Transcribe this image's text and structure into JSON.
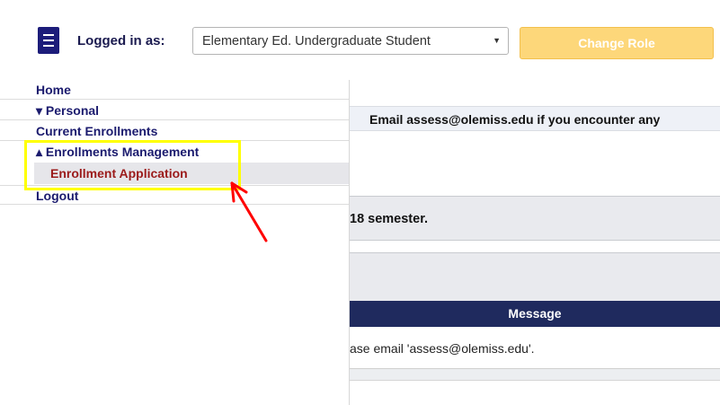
{
  "header": {
    "logged_in_label": "Logged in as:",
    "role_value": "Elementary Ed. Undergraduate Student",
    "change_role_label": "Change Role"
  },
  "sidebar": {
    "items": [
      {
        "label": "Home"
      },
      {
        "label": "▾ Personal"
      },
      {
        "label": "Current Enrollments"
      },
      {
        "label": "▴ Enrollments Management"
      },
      {
        "label": "Enrollment Application"
      },
      {
        "label": "Logout"
      }
    ]
  },
  "main": {
    "email_notice": "Email assess@olemiss.edu if you encounter any",
    "semester_text": "18 semester.",
    "table_header": "Message",
    "table_row": "ase email 'assess@olemiss.edu'."
  },
  "annotations": {
    "highlight_color": "#ffff00",
    "arrow_color": "#ff0000"
  },
  "colors": {
    "nav_text": "#1b1b6e",
    "active_item": "#9b1b1b",
    "table_header_bg": "#1f2a5e",
    "change_role_bg": "#fdd77a"
  }
}
